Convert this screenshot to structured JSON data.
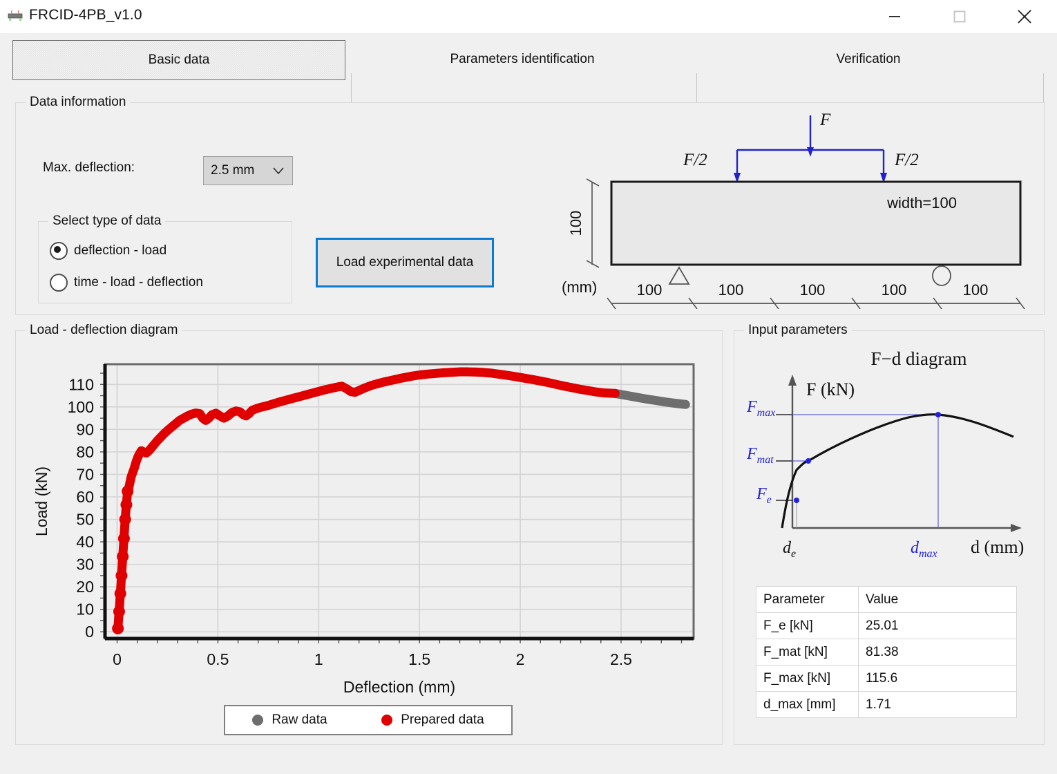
{
  "window": {
    "title": "FRCID-4PB_v1.0",
    "icon": "beam-icon",
    "minimize_label": "minimize-icon",
    "maximize_label": "maximize-icon",
    "close_label": "close-icon"
  },
  "tabs": [
    {
      "label": "Basic data",
      "selected": true
    },
    {
      "label": "Parameters identification",
      "selected": false
    },
    {
      "label": "Verification",
      "selected": false
    }
  ],
  "data_information": {
    "group_label": "Data information",
    "max_deflection_label": "Max. deflection:",
    "max_deflection_value": "2.5 mm",
    "max_deflection_options": [
      "2.5 mm"
    ],
    "select_type_group_label": "Select type of data",
    "radios": [
      {
        "label": "deflection - load",
        "selected": true
      },
      {
        "label": "time - load - deflection",
        "selected": false
      }
    ],
    "load_button_label": "Load experimental data",
    "load_button_accent": "#0a7bd1"
  },
  "beam_schematic": {
    "force_label": "F",
    "half_force_left": "F/2",
    "half_force_right": "F/2",
    "width_label": "width=100",
    "height_label": "100",
    "unit_label": "(mm)",
    "spans": [
      "100",
      "100",
      "100",
      "100",
      "100"
    ],
    "arrow_color": "#2222cc"
  },
  "load_deflection_diagram": {
    "group_label": "Load - deflection diagram",
    "legend": [
      {
        "label": "Raw data",
        "color": "#6e6e6e"
      },
      {
        "label": "Prepared data",
        "color": "#e00000"
      }
    ]
  },
  "chart_data": {
    "type": "scatter",
    "title": "",
    "xlabel": "Deflection (mm)",
    "ylabel": "Load (kN)",
    "xlim": [
      -0.06,
      2.86
    ],
    "ylim": [
      -3,
      119
    ],
    "xticks": [
      0,
      0.5,
      1,
      1.5,
      2,
      2.5
    ],
    "xticklabels": [
      "0",
      "0.5",
      "1",
      "1.5",
      "2",
      "2.5"
    ],
    "yticks": [
      0,
      10,
      20,
      30,
      40,
      50,
      60,
      70,
      80,
      90,
      100,
      110
    ],
    "yticklabels": [
      "0",
      "10",
      "20",
      "30",
      "40",
      "50",
      "60",
      "70",
      "80",
      "90",
      "100",
      "110"
    ],
    "grid": true,
    "legend_position": "bottom",
    "series": [
      {
        "name": "Raw data",
        "color": "#6e6e6e",
        "x": [
          2.47,
          2.52,
          2.57,
          2.62,
          2.67,
          2.72,
          2.77,
          2.82
        ],
        "y": [
          106.0,
          105.2,
          104.4,
          103.6,
          102.9,
          102.2,
          101.6,
          101.1
        ]
      },
      {
        "name": "Prepared data",
        "color": "#e00000",
        "x": [
          0.004,
          0.01,
          0.016,
          0.022,
          0.028,
          0.034,
          0.04,
          0.046,
          0.052,
          0.058,
          0.064,
          0.07,
          0.078,
          0.086,
          0.094,
          0.102,
          0.11,
          0.12,
          0.132,
          0.145,
          0.158,
          0.172,
          0.186,
          0.2,
          0.216,
          0.232,
          0.25,
          0.27,
          0.29,
          0.31,
          0.33,
          0.35,
          0.37,
          0.39,
          0.41,
          0.425,
          0.44,
          0.455,
          0.47,
          0.49,
          0.51,
          0.53,
          0.55,
          0.57,
          0.59,
          0.61,
          0.625,
          0.64,
          0.655,
          0.67,
          0.69,
          0.71,
          0.73,
          0.755,
          0.78,
          0.805,
          0.83,
          0.855,
          0.88,
          0.905,
          0.93,
          0.955,
          0.98,
          1.005,
          1.03,
          1.06,
          1.09,
          1.115,
          1.14,
          1.16,
          1.18,
          1.205,
          1.23,
          1.26,
          1.29,
          1.32,
          1.35,
          1.38,
          1.41,
          1.44,
          1.47,
          1.5,
          1.54,
          1.58,
          1.62,
          1.66,
          1.7,
          1.74,
          1.78,
          1.82,
          1.86,
          1.9,
          1.94,
          1.98,
          2.02,
          2.06,
          2.1,
          2.14,
          2.18,
          2.22,
          2.26,
          2.3,
          2.34,
          2.38,
          2.42,
          2.47
        ],
        "y": [
          1.5,
          9.0,
          17.0,
          25.0,
          33.5,
          41.5,
          50.0,
          56.5,
          62.5,
          64.0,
          66.5,
          69.0,
          71.0,
          73.0,
          75.5,
          77.5,
          79.0,
          80.5,
          80.0,
          79.5,
          80.5,
          82.0,
          83.5,
          85.0,
          86.5,
          88.0,
          89.5,
          91.0,
          92.5,
          94.0,
          95.0,
          96.0,
          96.8,
          97.3,
          97.0,
          95.0,
          94.0,
          95.0,
          96.5,
          97.2,
          96.0,
          95.0,
          96.0,
          97.5,
          98.2,
          97.8,
          96.6,
          96.0,
          97.0,
          98.5,
          99.2,
          99.8,
          100.2,
          100.8,
          101.5,
          102.2,
          102.8,
          103.4,
          104.0,
          104.6,
          105.2,
          105.8,
          106.4,
          107.0,
          107.6,
          108.2,
          108.8,
          109.2,
          108.0,
          106.8,
          106.5,
          107.5,
          108.5,
          109.5,
          110.3,
          111.0,
          111.6,
          112.2,
          112.8,
          113.3,
          113.8,
          114.2,
          114.6,
          114.9,
          115.2,
          115.4,
          115.6,
          115.6,
          115.5,
          115.3,
          115.0,
          114.5,
          114.0,
          113.4,
          112.8,
          112.2,
          111.5,
          110.8,
          110.0,
          109.2,
          108.5,
          107.8,
          107.2,
          106.6,
          106.2,
          106.0
        ]
      }
    ]
  },
  "input_parameters": {
    "group_label": "Input parameters",
    "fd_diagram": {
      "title": "F−d diagram",
      "y_axis_label": "F (kN)",
      "x_axis_label": "d (mm)",
      "markers": [
        {
          "label": "F",
          "sub": "max"
        },
        {
          "label": "F",
          "sub": "mat"
        },
        {
          "label": "F",
          "sub": "e"
        },
        {
          "label": "d",
          "sub": "e"
        },
        {
          "label": "d",
          "sub": "max"
        }
      ],
      "accent_color": "#2222dd"
    },
    "table": {
      "headers": [
        "Parameter",
        "Value"
      ],
      "rows": [
        [
          "F_e [kN]",
          "25.01"
        ],
        [
          "F_mat [kN]",
          "81.38"
        ],
        [
          "F_max [kN]",
          "115.6"
        ],
        [
          "d_max [mm]",
          "1.71"
        ]
      ]
    }
  }
}
